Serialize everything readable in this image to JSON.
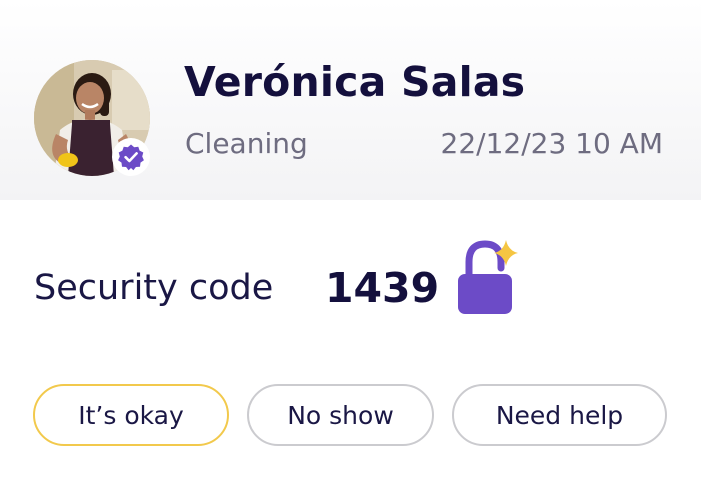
{
  "provider": {
    "name": "Verónica Salas",
    "service": "Cleaning",
    "datetime": "22/12/23 10 AM",
    "verified_icon": "verified-check-icon"
  },
  "security": {
    "label": "Security code",
    "code": "1439",
    "icon": "lock-sparkle-icon"
  },
  "actions": {
    "okay_label": "It’s okay",
    "noshow_label": "No show",
    "help_label": "Need help"
  },
  "colors": {
    "text_dark": "#14103d",
    "text_muted": "#6e6c80",
    "accent_purple": "#6c4bc7",
    "highlight_border": "#f2c94c",
    "sparkle": "#f5c542"
  }
}
